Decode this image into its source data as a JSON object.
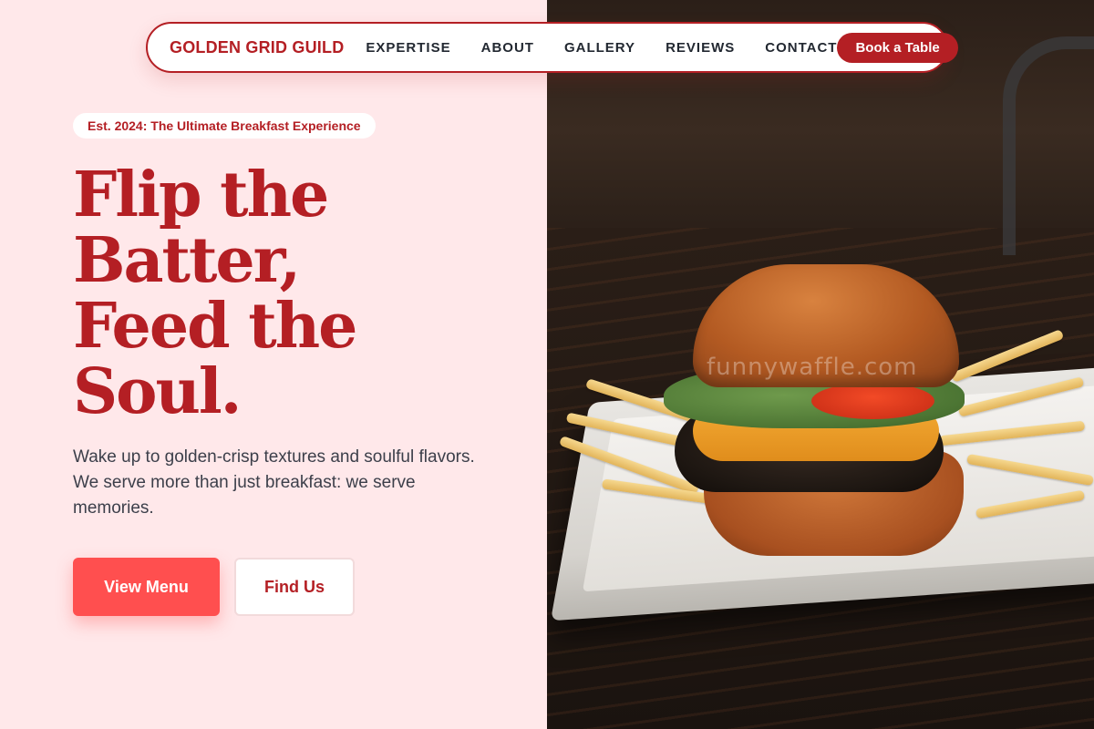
{
  "nav": {
    "brand": "GOLDEN GRID GUILD",
    "links": [
      "EXPERTISE",
      "ABOUT",
      "GALLERY",
      "REVIEWS",
      "CONTACT"
    ],
    "cta": "Book a Table"
  },
  "hero": {
    "badge": "Est. 2024: The Ultimate Breakfast Experience",
    "headline_lines": [
      "Flip the",
      "Batter,",
      "Feed the",
      "Soul."
    ],
    "subtext": "Wake up to golden-crisp textures and soulful flavors. We serve more than just breakfast: we serve memories.",
    "primary_button": "View Menu",
    "secondary_button": "Find Us"
  },
  "image": {
    "watermark": "funnywaffle.com",
    "subject": "burger-photo"
  },
  "colors": {
    "brand_red": "#b41f24",
    "accent_coral": "#ff4f4f",
    "panel_pink": "#ffe8ea"
  }
}
